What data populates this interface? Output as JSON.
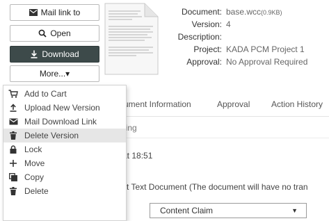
{
  "actions": {
    "mail_link": "Mail link to",
    "open": "Open",
    "download": "Download",
    "more": "More...▾"
  },
  "document": {
    "labels": {
      "document": "Document:",
      "version": "Version:",
      "description": "Description:",
      "project": "Project:",
      "approval": "Approval:"
    },
    "values": {
      "document": "base.wcc",
      "document_size": "(0.9KB)",
      "version": "4",
      "description": "",
      "project": "KADA PCM Project 1",
      "approval": "No Approval Required"
    }
  },
  "tabs": [
    {
      "label": "ument Information"
    },
    {
      "label": "Approval"
    },
    {
      "label": "Action History"
    }
  ],
  "subtab": "ping",
  "content": {
    "time_fragment": "at 18:51",
    "type_fragment": "t Text Document (The document will have no tran",
    "claim_select": "Content Claim",
    "claim_arrow": "▼"
  },
  "menu": {
    "items": [
      {
        "label": "Add to Cart",
        "icon": "cart-icon"
      },
      {
        "label": "Upload New Version",
        "icon": "upload-icon"
      },
      {
        "label": "Mail Download Link",
        "icon": "mail-icon"
      },
      {
        "label": "Delete Version",
        "icon": "trash-icon"
      },
      {
        "label": "Lock",
        "icon": "lock-icon"
      },
      {
        "label": "Move",
        "icon": "move-icon"
      },
      {
        "label": "Copy",
        "icon": "copy-icon"
      },
      {
        "label": "Delete",
        "icon": "trash-icon"
      }
    ],
    "highlighted_index": 3
  },
  "colors": {
    "download_bg": "#3d4a4a",
    "menu_highlight": "#e6e6e6",
    "value_text": "#666666"
  }
}
